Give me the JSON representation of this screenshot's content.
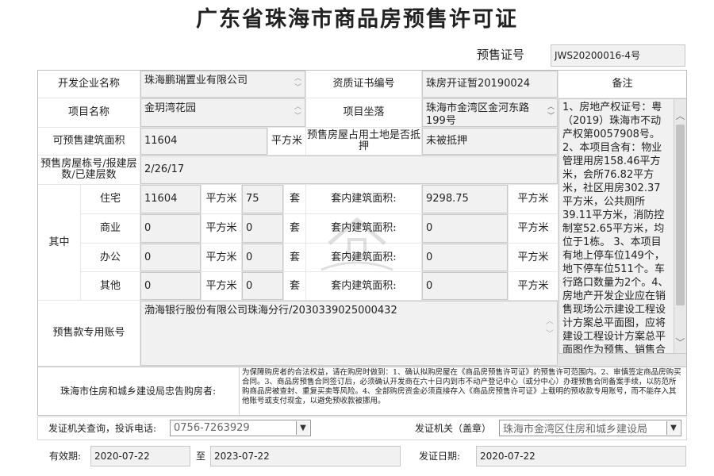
{
  "title": "广东省珠海市商品房预售许可证",
  "presale_no": {
    "label": "预售证号",
    "value": "JWS20200016-4号"
  },
  "developer": {
    "label": "开发企业名称",
    "value": "珠海鹏瑞置业有限公司"
  },
  "cert_no": {
    "label": "资质证书编号",
    "value": "珠房开证暂20190024"
  },
  "notes": {
    "label": "备注",
    "text": "1、房地产权证号：粤（2019）珠海市不动产权第0057908号。2、本项目含有：物业管理用房158.46平方米，会所76.82平方米，社区用房302.37平方米，公共厕所39.11平方米，消防控制室52.65平方米，均位于1栋。 3、本项目有地上停车位149个，地下停车位511个。车行路口数量为2个。4、房地产开发企业应在销售现场公示建设工程设计方案总平面图，应将建设工程设计方案总平面图作为预售、销售合同附"
  },
  "project": {
    "label": "项目名称",
    "value": "金玥湾花园"
  },
  "location": {
    "label": "项目坐落",
    "value": "珠海市金湾区金河东路199号"
  },
  "area": {
    "label": "可预售建筑面积",
    "value": "11604",
    "unit": "平方米"
  },
  "mortgage": {
    "label": "预售房屋占用土地是否抵押",
    "value": "未被抵押"
  },
  "buildings": {
    "label": "预售房屋栋号/报建层数/已建层数",
    "value": "2/26/17"
  },
  "breakdown": {
    "label": "其中",
    "unit": "平方米",
    "sets_unit": "套",
    "inner_label": "套内建筑面积:",
    "rows": [
      {
        "type": "住宅",
        "area": "11604",
        "sets": "75",
        "inner": "9298.75"
      },
      {
        "type": "商业",
        "area": "0",
        "sets": "0",
        "inner": "0"
      },
      {
        "type": "办公",
        "area": "0",
        "sets": "0",
        "inner": "0"
      },
      {
        "type": "其他",
        "area": "0",
        "sets": "0",
        "inner": "0"
      }
    ]
  },
  "account": {
    "label": "预售款专用账号",
    "value": "渤海银行股份有限公司珠海分行/2030339025000432"
  },
  "warning": {
    "label": "珠海市住房和城乡建设局忠告购房者:",
    "text": "为保障购房者的合法权益，请在购房时做到：1、确认拟购房屋在《商品房预售许可证》的预售许可范围内。2、审慎签定商品房购买合同。3、商品房预售合同签订后，必须确认开发商在六十日内到市不动产登记中心（或分中心）办理预售合同备案手续，以防范所购商品房被查封、重复买卖等风险。4、全部购房资金必须直接存入《商品房预售许可证》上载明的预收款专用账号，而不能存入其他账号或支付现金，以避免预收款被挪用。"
  },
  "phone": {
    "label": "发证机关查询，投诉电话:",
    "value": "0756-7263929"
  },
  "issuer": {
    "label": "发证机关（盖章）",
    "value": "珠海市金湾区住房和城乡建设局"
  },
  "validity": {
    "label": "有效期:",
    "from": "2020-07-22",
    "to_label": "至",
    "to": "2023-07-22"
  },
  "issue_date": {
    "label": "发证日期:",
    "value": "2020-07-22"
  }
}
